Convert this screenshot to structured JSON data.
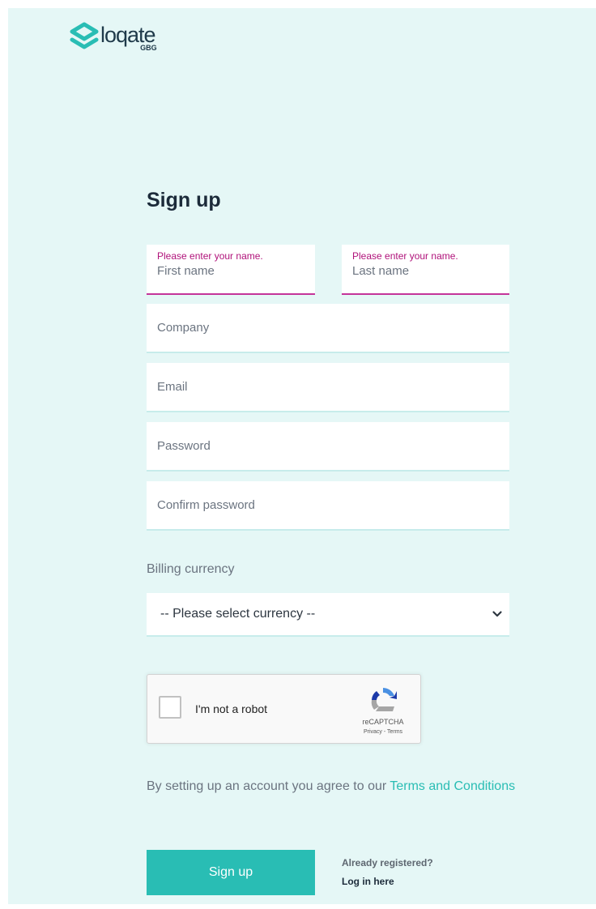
{
  "brand": {
    "name": "loqate",
    "sub": "GBG",
    "colors": {
      "accent": "#29bdb4",
      "error": "#b0127a",
      "background": "#e5f7f6",
      "dark": "#1c2b3a"
    }
  },
  "form": {
    "title": "Sign up",
    "first_name": {
      "placeholder": "First name",
      "error": "Please enter your name."
    },
    "last_name": {
      "placeholder": "Last name",
      "error": "Please enter your name."
    },
    "company": {
      "placeholder": "Company"
    },
    "email": {
      "placeholder": "Email"
    },
    "password": {
      "placeholder": "Password"
    },
    "confirm_password": {
      "placeholder": "Confirm password"
    },
    "billing": {
      "label": "Billing currency",
      "selected": "-- Please select currency --",
      "icon": "chevron-down-icon"
    }
  },
  "captcha": {
    "label": "I'm not a robot",
    "brand": "reCAPTCHA",
    "links": "Privacy - Terms",
    "icon": "recaptcha-logo-icon"
  },
  "terms": {
    "prefix": "By setting up an account you agree to our ",
    "link": "Terms and Conditions"
  },
  "actions": {
    "signup": "Sign up",
    "already": "Already registered?",
    "login": "Log in here"
  }
}
